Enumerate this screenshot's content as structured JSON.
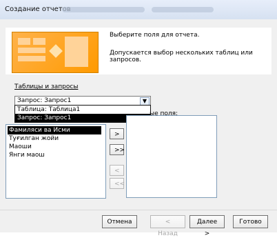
{
  "window": {
    "title": "Создание отчетов"
  },
  "header": {
    "line1": "Выберите поля для отчета.",
    "line2": "Допускается выбор нескольких таблиц или запросов."
  },
  "tables": {
    "label": "Таблицы и запросы",
    "selected": "Запрос: Запрос1",
    "options": [
      "Таблица: Таблица1",
      "Запрос: Запрос1"
    ]
  },
  "available": {
    "label_tail": "ые поля:",
    "items": [
      "Фамиляси ва Исми",
      "Туғилган жойи",
      "Маоши",
      "Янги маош"
    ]
  },
  "buttons": {
    "add": ">",
    "add_all": ">>",
    "remove": "<",
    "remove_all": "<<",
    "cancel": "Отмена",
    "back": "< Назад",
    "next": "Далее >",
    "finish": "Готово"
  }
}
